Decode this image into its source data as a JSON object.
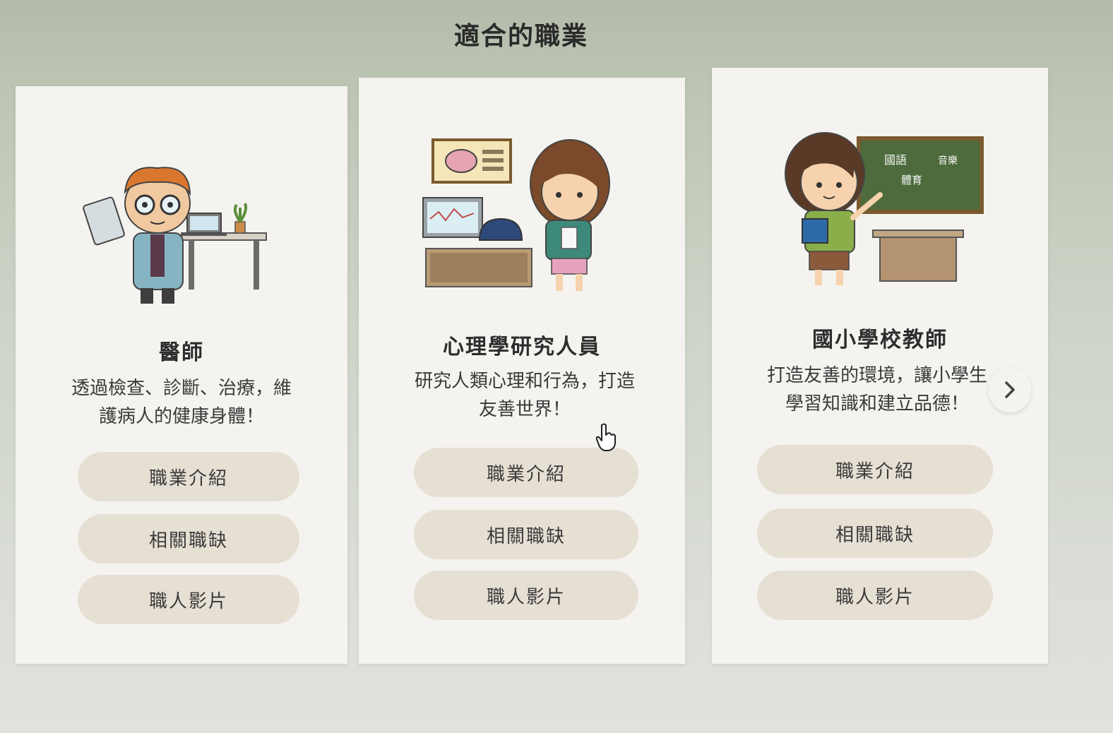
{
  "section": {
    "title": "適合的職業"
  },
  "cards": [
    {
      "icon": "doctor-illustration-icon",
      "title": "醫師",
      "description": "透過檢查、診斷、治療，維護病人的健康身體！",
      "buttons": [
        "職業介紹",
        "相關職缺",
        "職人影片"
      ]
    },
    {
      "icon": "psychology-researcher-illustration-icon",
      "title": "心理學研究人員",
      "description": "研究人類心理和行為，打造友善世界！",
      "buttons": [
        "職業介紹",
        "相關職缺",
        "職人影片"
      ]
    },
    {
      "icon": "elementary-teacher-illustration-icon",
      "title": "國小學校教師",
      "description": "打造友善的環境，讓小學生學習知識和建立品德！",
      "buttons": [
        "職業介紹",
        "相關職缺",
        "職人影片"
      ]
    }
  ],
  "chalkboard_text": [
    "國語",
    "音樂",
    "體育"
  ],
  "carousel": {
    "next_icon": "chevron-right-icon"
  },
  "colors": {
    "card_bg": "#f4f3ef",
    "button_bg": "#e6dfd3",
    "text": "#2d2d2d",
    "chalkboard": "#4d6b3c"
  }
}
